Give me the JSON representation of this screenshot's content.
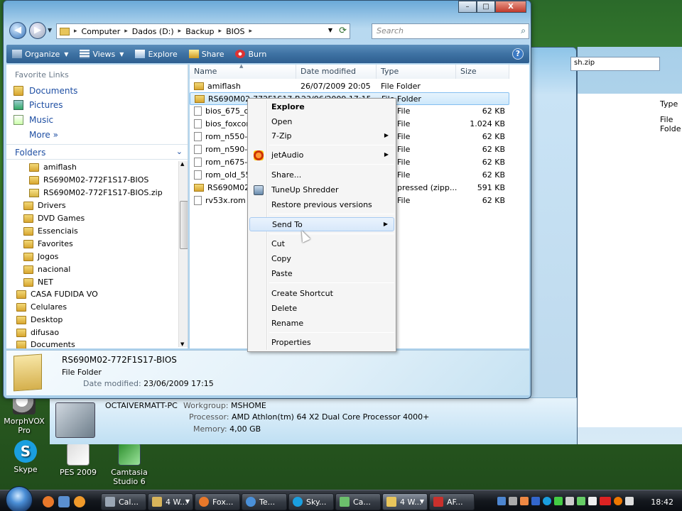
{
  "desktop": {
    "icons": [
      {
        "label": "MorphVOX\nPro",
        "label1": "MorphVOX",
        "label2": "Pro"
      },
      {
        "label": "Skype"
      },
      {
        "label": "PES 2009"
      },
      {
        "label1": "Camtasia",
        "label2": "Studio 6"
      }
    ]
  },
  "bg_window": {
    "address": "sh.zip",
    "type_header": "Type",
    "type_value": "File Folde",
    "computer_name": "OCTAIVERMATT-PC",
    "workgroup_label": "Workgroup:",
    "workgroup": "MSHOME",
    "processor_label": "Processor:",
    "processor": "AMD Athlon(tm) 64 X2 Dual Core Processor 4000+",
    "memory_label": "Memory:",
    "memory": "4,00 GB"
  },
  "window": {
    "controls": {
      "minimize": "–",
      "maximize": "□",
      "close": "X"
    },
    "breadcrumb": [
      "Computer",
      "Dados (D:)",
      "Backup",
      "BIOS"
    ],
    "search_placeholder": "Search",
    "toolbar": {
      "organize": "Organize",
      "views": "Views",
      "explore": "Explore",
      "share": "Share",
      "burn": "Burn"
    }
  },
  "nav": {
    "favorite_links_title": "Favorite Links",
    "favorites": [
      "Documents",
      "Pictures",
      "Music"
    ],
    "more": "More",
    "folders_title": "Folders",
    "tree": [
      {
        "label": "amiflash",
        "type": "folder"
      },
      {
        "label": "RS690M02-772F1S17-BIOS",
        "type": "folder"
      },
      {
        "label": "RS690M02-772F1S17-BIOS.zip",
        "type": "zip"
      },
      {
        "label": "Drivers",
        "type": "folder"
      },
      {
        "label": "DVD Games",
        "type": "folder"
      },
      {
        "label": "Essenciais",
        "type": "folder"
      },
      {
        "label": "Favorites",
        "type": "folder"
      },
      {
        "label": "Jogos",
        "type": "folder"
      },
      {
        "label": "nacional",
        "type": "folder"
      },
      {
        "label": "NET",
        "type": "folder"
      },
      {
        "label": "CASA FUDIDA VO",
        "type": "folder"
      },
      {
        "label": "Celulares",
        "type": "folder"
      },
      {
        "label": "Desktop",
        "type": "folder"
      },
      {
        "label": "difusao",
        "type": "folder"
      },
      {
        "label": "Documents",
        "type": "folder"
      }
    ]
  },
  "files": {
    "columns": {
      "name": "Name",
      "date": "Date modified",
      "type": "Type",
      "size": "Size"
    },
    "rows": [
      {
        "name": "amiflash",
        "date": "26/07/2009 20:05",
        "type": "File Folder",
        "size": "",
        "icon": "folder"
      },
      {
        "name": "RS690M02-772F1S17-B",
        "date": "23/06/2009 17:15",
        "type": "File Folder",
        "size": "",
        "icon": "folder",
        "selected": true
      },
      {
        "name": "bios_675_old",
        "date": "",
        "type": "File",
        "size": "62 KB",
        "icon": "doc"
      },
      {
        "name": "bios_foxconn",
        "date": "",
        "type": "File",
        "size": "1.024 KB",
        "icon": "doc"
      },
      {
        "name": "rom_n550-70",
        "date": "",
        "type": "File",
        "size": "62 KB",
        "icon": "doc"
      },
      {
        "name": "rom_n590-70",
        "date": "",
        "type": "File",
        "size": "62 KB",
        "icon": "doc"
      },
      {
        "name": "rom_n675-70",
        "date": "",
        "type": "File",
        "size": "62 KB",
        "icon": "doc"
      },
      {
        "name": "rom_old_550",
        "date": "",
        "type": "File",
        "size": "62 KB",
        "icon": "doc"
      },
      {
        "name": "RS690M02-7",
        "date": "",
        "type": "pressed (zipp...",
        "size": "591 KB",
        "icon": "zip"
      },
      {
        "name": "rv53x.rom",
        "date": "",
        "type": "File",
        "size": "62 KB",
        "icon": "doc"
      }
    ]
  },
  "details": {
    "name": "RS690M02-772F1S17-BIOS",
    "type": "File Folder",
    "modified_label": "Date modified:",
    "modified": "23/06/2009 17:15"
  },
  "context_menu": {
    "items": [
      {
        "label": "Explore",
        "bold": true
      },
      {
        "label": "Open"
      },
      {
        "label": "7-Zip",
        "submenu": true
      },
      {
        "label": "jetAudio",
        "submenu": true,
        "icon": "jetaudio-icon"
      },
      {
        "label": "Share..."
      },
      {
        "label": "TuneUp Shredder",
        "icon": "tuneup-icon"
      },
      {
        "label": "Restore previous versions"
      },
      {
        "label": "Send To",
        "submenu": true,
        "hover": true
      },
      {
        "label": "Cut"
      },
      {
        "label": "Copy"
      },
      {
        "label": "Paste"
      },
      {
        "label": "Create Shortcut"
      },
      {
        "label": "Delete"
      },
      {
        "label": "Rename"
      },
      {
        "label": "Properties"
      }
    ]
  },
  "taskbar": {
    "buttons": [
      {
        "label": "Cal...",
        "color": "#9aa6b4"
      },
      {
        "label": "4 W...",
        "color": "#d8b45a"
      },
      {
        "label": "Fox...",
        "color": "#e8782a"
      },
      {
        "label": "Te...",
        "color": "#4a90d9"
      },
      {
        "label": "Sky...",
        "color": "#1a9fe0"
      },
      {
        "label": "Ca...",
        "color": "#6cc06c"
      },
      {
        "label": "4 W...",
        "color": "#e8c55b"
      },
      {
        "label": "AF...",
        "color": "#c9302c"
      }
    ],
    "clock": "18:42"
  }
}
